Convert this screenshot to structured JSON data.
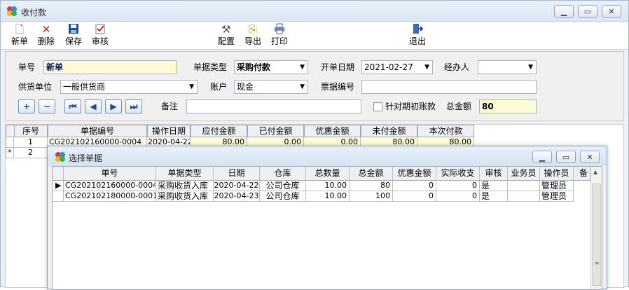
{
  "window": {
    "title": "收付款"
  },
  "toolbar": {
    "new": "新单",
    "delete": "删除",
    "save": "保存",
    "audit": "审核",
    "config": "配置",
    "export": "导出",
    "print": "打印",
    "exit": "退出"
  },
  "form": {
    "doc_no_label": "单号",
    "doc_no_value": "新单",
    "doc_type_label": "单据类型",
    "doc_type_value": "采购付款",
    "date_label": "开单日期",
    "date_value": "2021-02-27",
    "handler_label": "经办人",
    "handler_value": "",
    "supplier_label": "供货单位",
    "supplier_value": "一般供货商",
    "account_label": "账户",
    "account_value": "现金",
    "bill_no_label": "票据编号",
    "bill_no_value": "",
    "remark_label": "备注",
    "remark_value": "",
    "opening_label": "针对期初账款",
    "total_label": "总金额",
    "total_value": "80"
  },
  "grid": {
    "columns": [
      "序号",
      "单据编号",
      "操作日期",
      "应付金额",
      "已付金额",
      "优惠金额",
      "未付金额",
      "本次付款"
    ],
    "rows": [
      {
        "seq": "1",
        "doc_no": "CG202102160000-0004",
        "date": "2020-04-22",
        "payable": "80.00",
        "paid": "0.00",
        "discount": "0.00",
        "unpaid": "80.00",
        "this_pay": "80.00"
      },
      {
        "seq": "2",
        "doc_no": "",
        "date": "",
        "payable": "",
        "paid": "",
        "discount": "",
        "unpaid": "",
        "this_pay": ""
      }
    ],
    "new_row_marker": "*"
  },
  "dialog": {
    "title": "选择单据",
    "columns": [
      "单号",
      "单据类型",
      "日期",
      "仓库",
      "总数量",
      "总金额",
      "优惠金额",
      "实际收支",
      "审核",
      "业务员",
      "操作员",
      "备"
    ],
    "rows": [
      {
        "no": "CG202102160000-0004",
        "type": "采购收货入库",
        "date": "2020-04-22",
        "warehouse": "公司仓库",
        "qty": "10.00",
        "amount": "80",
        "discount": "0",
        "actual": "0",
        "audit": "是",
        "salesman": "",
        "operator": "管理员"
      },
      {
        "no": "CG202102180000-0001",
        "type": "采购收货入库",
        "date": "2020-04-23",
        "warehouse": "公司仓库",
        "qty": "10.00",
        "amount": "100",
        "discount": "0",
        "actual": "0",
        "audit": "是",
        "salesman": "",
        "operator": "管理员"
      }
    ]
  },
  "colors": {
    "accent": "#1948a0",
    "money_bg": "#fffbd6",
    "title_bg": "#dbe6f4"
  }
}
